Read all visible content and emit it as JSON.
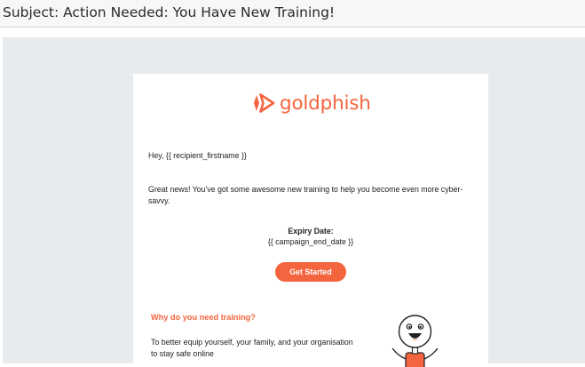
{
  "email": {
    "subject": "Subject: Action Needed: You Have New Training!"
  },
  "brand": {
    "name": "goldphish",
    "logo_icon": "play-arrow-logo-icon",
    "accent_color": "#f4643e"
  },
  "body": {
    "greeting": "Hey, {{ recipient_firstname }}",
    "intro": "Great news! You've got some awesome new training to help you become even more cyber-savvy.",
    "expiry_label": "Expiry Date:",
    "expiry_value": "{{ campaign_end_date }}",
    "cta_label": "Get Started",
    "why_heading": "Why do you need training?",
    "why_text": "To better equip yourself, your family, and your organisation to stay safe online"
  },
  "illustration": {
    "icon": "cartoon-person-icon"
  }
}
